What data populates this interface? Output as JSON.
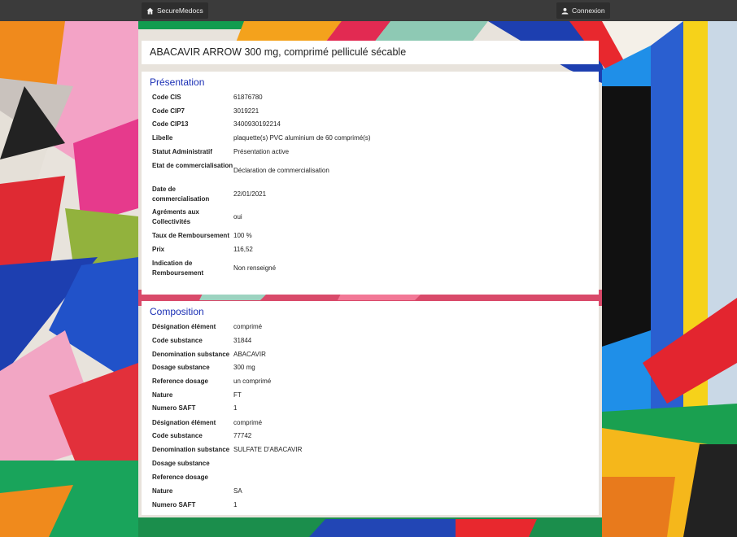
{
  "navbar": {
    "brand_label": "SecureMedocs",
    "login_label": "Connexion"
  },
  "page_title": "ABACAVIR ARROW 300 mg, comprimé pelliculé sécable",
  "presentation": {
    "section_title": "Présentation",
    "rows": [
      {
        "label": "Code CIS",
        "value": "61876780"
      },
      {
        "label": "Code CIP7",
        "value": "3019221"
      },
      {
        "label": "Code CIP13",
        "value": "3400930192214"
      },
      {
        "label": "Libelle",
        "value": "plaquette(s) PVC aluminium de 60 comprimé(s)"
      },
      {
        "label": "Statut Administratif",
        "value": "Présentation active"
      },
      {
        "label": "Etat de commercialisation",
        "value": "Déclaration de commercialisation"
      },
      {
        "label": "Date de commercialisation",
        "value": "22/01/2021"
      },
      {
        "label": "Agréments aux Collectivités",
        "value": "oui"
      },
      {
        "label": "Taux de Remboursement",
        "value": "100 %"
      },
      {
        "label": "Prix",
        "value": "116,52"
      },
      {
        "label": "Indication de Remboursement",
        "value": "Non renseigné"
      }
    ]
  },
  "composition": {
    "section_title": "Composition",
    "rows": [
      {
        "label": "Désignation élément",
        "value": "comprimé"
      },
      {
        "label": "Code substance",
        "value": "31844"
      },
      {
        "label": "Denomination substance",
        "value": "ABACAVIR"
      },
      {
        "label": "Dosage substance",
        "value": "300 mg"
      },
      {
        "label": "Reference dosage",
        "value": "un comprimé"
      },
      {
        "label": "Nature",
        "value": "FT"
      },
      {
        "label": "Numero SAFT",
        "value": "1"
      },
      {
        "label": "Désignation élément",
        "value": "comprimé"
      },
      {
        "label": "Code substance",
        "value": "77742"
      },
      {
        "label": "Denomination substance",
        "value": "SULFATE D'ABACAVIR"
      },
      {
        "label": "Dosage substance",
        "value": ""
      },
      {
        "label": "Reference dosage",
        "value": ""
      },
      {
        "label": "Nature",
        "value": "SA"
      },
      {
        "label": "Numero SAFT",
        "value": "1"
      }
    ]
  },
  "icons": {
    "brand": "home-icon",
    "login": "user-icon"
  }
}
